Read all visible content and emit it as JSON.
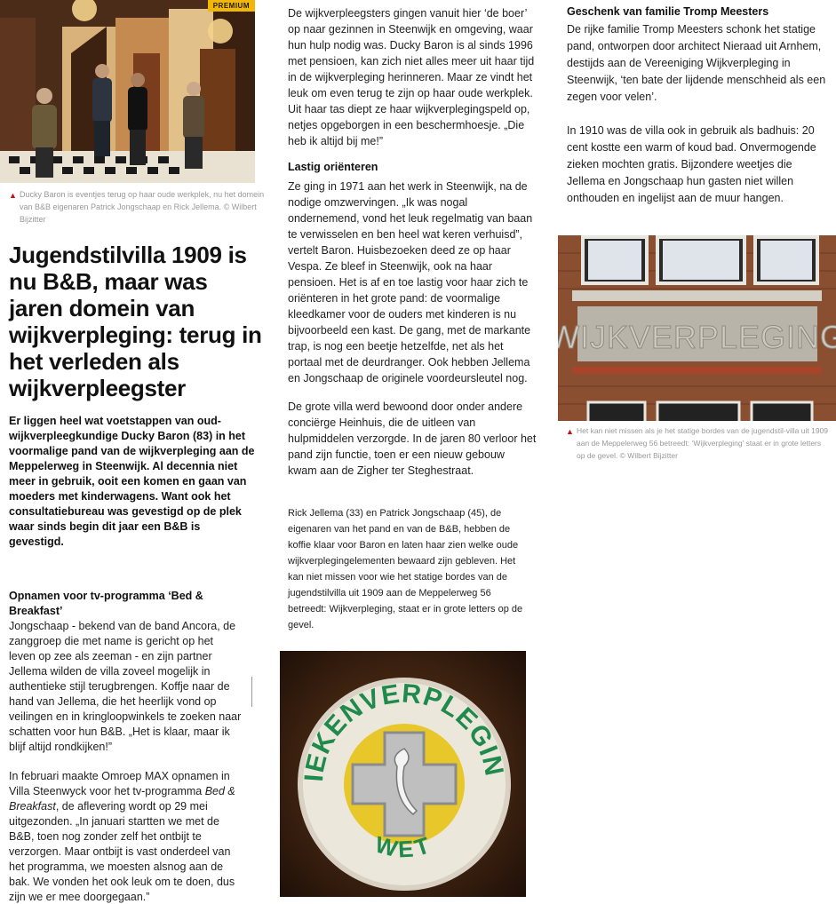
{
  "photo1": {
    "badge": "PREMIUM",
    "caption": "Ducky Baron is eventjes terug op haar oude werkplek, nu het domein van B&B eigenaren Patrick Jongschaap en Rick Jellema. © Wilbert Bijzitter"
  },
  "headline": "Jugendstilvilla 1909 is nu B&B, maar was jaren domein van wijkverpleging: terug in het verleden als wijkverpleegster",
  "lead": "Er liggen heel wat voetstappen van oud-wijkverpleegkundige Ducky Baron (83) in het voormalige pand van de wijkverpleging aan de Meppelerweg in Steenwijk. Al decennia niet meer in gebruik, ooit een komen en gaan van moeders met kinderwagens. Want ook het consultatiebureau was gevestigd op de plek waar sinds begin dit jaar een B&B is gevestigd.",
  "section1": {
    "heading": "Opnamen voor tv-programma ‘Bed & Breakfast’",
    "p1": "Jongschaap - bekend van de band Ancora, de zanggroep die met name is gericht op het leven op zee als zeeman - en zijn partner Jellema wilden de villa zoveel mogelijk in authentieke stijl terugbrengen. Koffje naar de hand van Jellema, die het heerlijk vond op veilingen en in kringloopwinkels te zoeken naar schatten voor hun B&B. „Het is klaar, maar ik blijf altijd rondkijken!”",
    "p2_a": "In februari maakte Omroep MAX opnamen in Villa Steenwyck voor het tv-programma ",
    "p2_em": "Bed & Breakfast",
    "p2_b": ", de aflevering wordt op 29 mei uitgezonden. „In januari startten we met de B&B, toen nog zonder zelf het ontbijt te verzorgen. Maar ontbijt is vast onderdeel van het programma, we moesten alsnog aan de bak. We vonden het ook leuk om te doen, dus zijn we er mee doorgegaan.”"
  },
  "col2": {
    "p3": "De wijkverpleegsters gingen vanuit hier ‘de boer’ op naar gezinnen in Steenwijk en omgeving, waar hun hulp nodig was. Ducky Baron is al sinds 1996 met pensioen, kan zich niet alles meer uit haar tijd in de wijkverpleging herinneren. Maar ze vindt het leuk om even terug te zijn op haar oude werkplek. Uit haar tas diept ze haar wijkverplegingspeld op, netjes opgeborgen in een beschermhoesje. „Die heb ik altijd bij me!”",
    "heading": "Lastig oriënteren",
    "p4": "Ze ging in 1971 aan het werk in Steenwijk, na de nodige omzwervingen. „Ik was nogal ondernemend, vond het leuk regelmatig van baan te verwisselen en ben heel wat keren verhuisd”, vertelt Baron. Huisbezoeken deed ze op haar Vespa. Ze bleef in Steenwijk, ook na haar pensioen. Het is af en toe lastig voor haar zich te oriënteren in het grote pand: de voormalige kleedkamer voor de ouders met kinderen is nu bijvoorbeeld een kast. De gang, met de markante trap, is nog een beetje hetzelfde, net als het portaal met de deurdranger. Ook hebben Jellema en Jongschaap de originele voordeursleutel nog.",
    "p5": "De grote villa werd bewoond door onder andere conciërge Heinhuis, die de uitleen van hulpmiddelen verzorgde. In de jaren 80 verloor het pand zijn functie, toen er een nieuw gebouw kwam aan de Zigher ter Steghestraat.",
    "p6": "Rick Jellema (33) en Patrick Jongschaap (45), de eigenaren van het pand en van de B&B, hebben de koffie klaar voor Baron en laten haar zien welke oude wijkverplegingelementen bewaard zijn gebleven. Het kan niet missen voor wie het statige bordes van de jugendstilvilla uit 1909 aan de Meppelerweg 56 betreedt: Wijkverpleging, staat er in grote letters op de gevel.",
    "pin_text_top": "ZIEKENVERPLEGING",
    "pin_text_bottom": "WET"
  },
  "col3": {
    "heading": "Geschenk van familie Tromp Meesters",
    "p7": "De rijke familie Tromp Meesters schonk het statige pand, ontworpen door architect Nieraad uit Arnhem, destijds aan de Vereeniging Wijkverpleging in Steenwijk, ‘ten bate der lijdende menschheid als een zegen voor velen’.",
    "p8": "In 1910 was de villa ook in gebruik als badhuis: 20 cent kostte een warm of koud bad. Onvermogende zieken mochten gratis. Bijzondere weetjes die Jellema en Jongschaap hun gasten niet willen onthouden en ingelijst aan de muur hangen.",
    "facade_text": "WIJKVERPLEGING",
    "caption": "Het kan niet missen als je het statige bordes van de jugendstil-villa uit 1909 aan de Meppelerweg 56 betreedt: ‘Wijkverpleging’ staat er in grote letters op de gevel. © Wilbert Bijzitter"
  },
  "colors": {
    "accent": "#c0101a",
    "badge": "#f2b705",
    "pin_green": "#1f8a4c",
    "pin_yellow": "#e8c72a"
  }
}
